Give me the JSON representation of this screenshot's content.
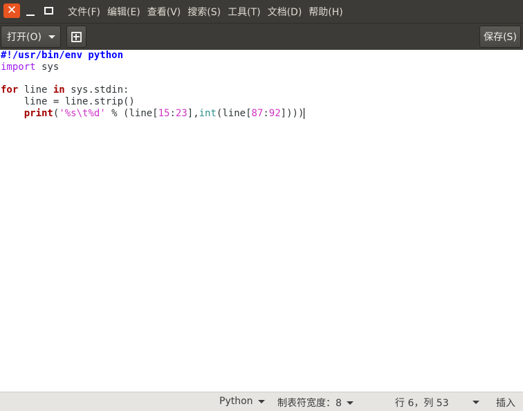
{
  "window": {
    "close_glyph": "✕",
    "accent_color": "#e95420"
  },
  "menu": [
    "文件(F)",
    "编辑(E)",
    "查看(V)",
    "搜索(S)",
    "工具(T)",
    "文档(D)",
    "帮助(H)"
  ],
  "toolbar": {
    "open_label": "打开(O)",
    "save_label": "保存(S)",
    "new_icon": "new-document-icon"
  },
  "code": {
    "line1": "#!/usr/bin/env python",
    "line2_kw": "import",
    "line2_rest": " sys",
    "line4_for": "for",
    "line4_mid": " line ",
    "line4_in": "in",
    "line4_rest": " sys.stdin:",
    "line5": "    line = line.strip()",
    "line6_indent": "    ",
    "line6_print": "print",
    "line6_p1": "(",
    "line6_str": "'%s\\t%d'",
    "line6_p2": " % (line[",
    "line6_n1": "15",
    "line6_c1": ":",
    "line6_n2": "23",
    "line6_p3": "],",
    "line6_int": "int",
    "line6_p4": "(line[",
    "line6_n3": "87",
    "line6_c2": ":",
    "line6_n4": "92",
    "line6_p5": "]))"
  },
  "status": {
    "language": "Python",
    "tab_width": "制表符宽度：8",
    "position": "行 6，列 53",
    "insert_mode": "插入"
  }
}
